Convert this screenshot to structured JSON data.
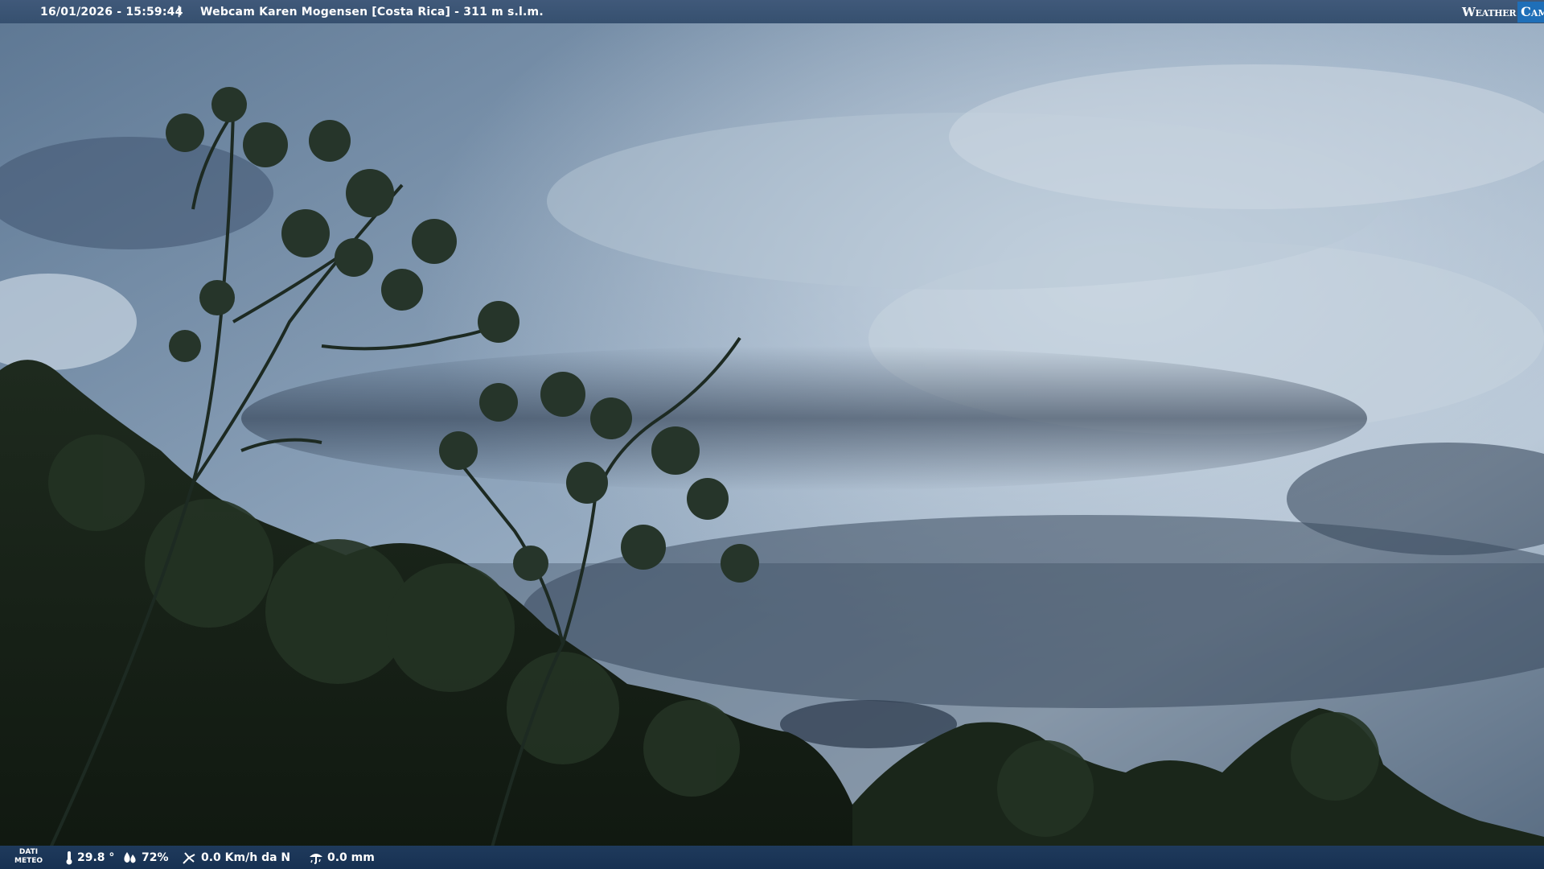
{
  "header": {
    "datetime": "16/01/2026 - 15:59:44",
    "separator": "|",
    "title": "Webcam Karen Mogensen [Costa Rica]  - 311 m s.l.m.",
    "brand_left": "Weather",
    "brand_right": "Cam",
    "brand_color": "#1f6fb8"
  },
  "footer": {
    "meteo_line1": "DATI",
    "meteo_line2": "METEO",
    "temperature": "29.8 °",
    "humidity": "72%",
    "wind": "0.0 Km/h da N",
    "rain": "0.0 mm"
  },
  "icons": {
    "temperature": "thermometer-icon",
    "humidity": "humidity-drops-icon",
    "wind": "wind-icon",
    "rain": "rain-icon"
  }
}
